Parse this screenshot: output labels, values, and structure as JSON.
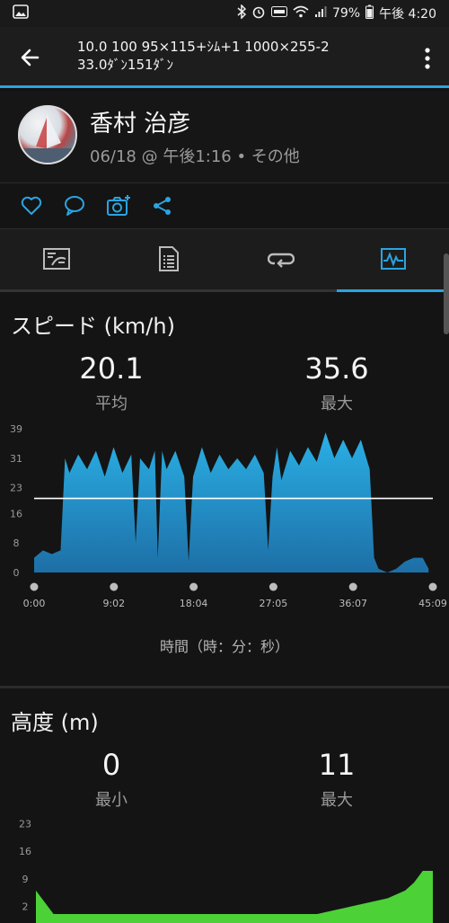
{
  "status_bar": {
    "battery": "79%",
    "clock": "午後 4:20"
  },
  "app_bar": {
    "title_line1": "10.0 100 95×115+ｼﾑ+1 1000×255-2",
    "title_line2": "33.0ﾀﾞﾝ151ﾀﾞﾝ"
  },
  "profile": {
    "name": "香村 治彦",
    "meta": "06/18 @ 午後1:16 • その他"
  },
  "speed": {
    "title": "スピード (km/h)",
    "avg_value": "20.1",
    "avg_label": "平均",
    "max_value": "35.6",
    "max_label": "最大",
    "x_axis_caption": "時間（時：分：秒）"
  },
  "altitude": {
    "title": "高度 (m)",
    "min_value": "0",
    "min_label": "最小",
    "max_value": "11",
    "max_label": "最大"
  },
  "colors": {
    "accent": "#2aa4e0",
    "speed_fill_top": "#2ab0e6",
    "speed_fill_bottom": "#1d6fa6",
    "altitude_fill": "#4cd137",
    "avg_line": "#ffffff"
  },
  "chart_data": [
    {
      "type": "area",
      "title": "スピード (km/h)",
      "xlabel": "時間（時：分：秒）",
      "ylabel": "",
      "yticks": [
        0,
        8,
        16,
        23,
        31,
        39
      ],
      "ylim": [
        0,
        39
      ],
      "xticks": [
        "0:00",
        "9:02",
        "18:04",
        "27:05",
        "36:07",
        "45:09"
      ],
      "xlim_seconds": [
        0,
        2709
      ],
      "avg_line": 20.1,
      "x": [
        0,
        60,
        120,
        180,
        210,
        240,
        300,
        360,
        420,
        480,
        540,
        600,
        660,
        690,
        720,
        780,
        820,
        840,
        870,
        900,
        960,
        1020,
        1050,
        1080,
        1140,
        1200,
        1260,
        1320,
        1380,
        1440,
        1500,
        1560,
        1590,
        1620,
        1650,
        1680,
        1740,
        1800,
        1860,
        1920,
        1980,
        2040,
        2100,
        2160,
        2220,
        2280,
        2310,
        2340,
        2400,
        2460,
        2520,
        2580,
        2640,
        2680
      ],
      "values": [
        4,
        6,
        5,
        6,
        28,
        30,
        29,
        31,
        30,
        29,
        31,
        30,
        29,
        8,
        28,
        31,
        30,
        4,
        30,
        31,
        30,
        29,
        3,
        29,
        31,
        30,
        29,
        31,
        28,
        31,
        29,
        30,
        6,
        29,
        31,
        28,
        30,
        32,
        31,
        33,
        35,
        34,
        33,
        34,
        33,
        31,
        4,
        1,
        0,
        1,
        3,
        4,
        4,
        1
      ],
      "series": [
        {
          "name": "",
          "values": []
        }
      ]
    },
    {
      "type": "area",
      "title": "高度 (m)",
      "yticks": [
        2,
        9,
        16,
        23
      ],
      "x": [
        0,
        120,
        240,
        360,
        480,
        600,
        720,
        840,
        960,
        1080,
        1200,
        1320,
        1440,
        1560,
        1680,
        1800,
        1920,
        2040,
        2160,
        2280,
        2400,
        2520,
        2580,
        2640,
        2709
      ],
      "values": [
        6,
        0,
        0,
        0,
        0,
        0,
        0,
        0,
        0,
        0,
        0,
        0,
        0,
        0,
        0,
        0,
        0,
        1,
        2,
        3,
        4,
        6,
        8,
        11,
        11
      ]
    }
  ]
}
